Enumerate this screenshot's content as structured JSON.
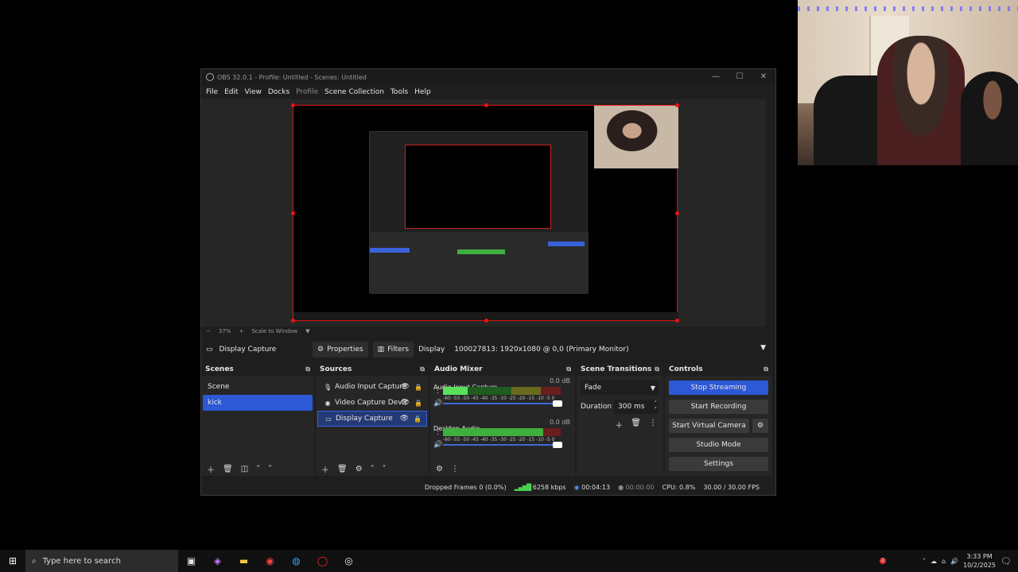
{
  "window": {
    "title": "OBS 32.0.1 - Profile: Untitled - Scenes: Untitled",
    "controls": [
      "—",
      "☐",
      "✕"
    ]
  },
  "menu": [
    "File",
    "Edit",
    "View",
    "Docks",
    "Profile",
    "Scene Collection",
    "Tools",
    "Help"
  ],
  "zoom": {
    "minus": "−",
    "percent": "37%",
    "plus": "+",
    "mode": "Scale to Window"
  },
  "source_bar": {
    "selected_source": "Display Capture",
    "properties_label": "Properties",
    "filters_label": "Filters",
    "display_label": "Display",
    "display_value": "100027813: 1920x1080 @ 0,0 (Primary Monitor)"
  },
  "scenes": {
    "title": "Scenes",
    "items": [
      "Scene",
      "kick"
    ],
    "selected": 1
  },
  "sources": {
    "title": "Sources",
    "items": [
      {
        "name": "Audio Input Capture",
        "icon": "microphone-icon"
      },
      {
        "name": "Video Capture Devic",
        "icon": "camera-icon"
      },
      {
        "name": "Display Capture",
        "icon": "monitor-icon"
      }
    ],
    "selected": 2
  },
  "mixer": {
    "title": "Audio Mixer",
    "channels": [
      {
        "name": "Audio Input Capture",
        "db": "0.0 dB",
        "level": 0.21,
        "peak": 0.6
      },
      {
        "name": "Desktop Audio",
        "db": "0.0 dB",
        "level": 0.85,
        "peak": 0.85
      }
    ],
    "scale": "-60 -55 -50 -45 -40 -35 -30 -25 -20 -15 -10 -5 0"
  },
  "transitions": {
    "title": "Scene Transitions",
    "type": "Fade",
    "duration_label": "Duration",
    "duration_value": "300 ms"
  },
  "controls": {
    "title": "Controls",
    "stop_streaming": "Stop Streaming",
    "start_recording": "Start Recording",
    "start_virtual_camera": "Start Virtual Camera",
    "studio_mode": "Studio Mode",
    "settings": "Settings"
  },
  "status": {
    "dropped": "Dropped Frames 0 (0.0%)",
    "bitrate": "6258 kbps",
    "stream_time": "00:04:13",
    "rec_time": "00:00:00",
    "cpu": "CPU: 0.8%",
    "fps": "30.00 / 30.00 FPS"
  },
  "taskbar": {
    "search_placeholder": "Type here to search",
    "time": "3:33 PM",
    "date": "10/2/2025",
    "notification_count": "2"
  },
  "colors": {
    "accent": "#2d58d6",
    "red_outline": "#dd1111",
    "meter_green": "#5ce05c"
  }
}
